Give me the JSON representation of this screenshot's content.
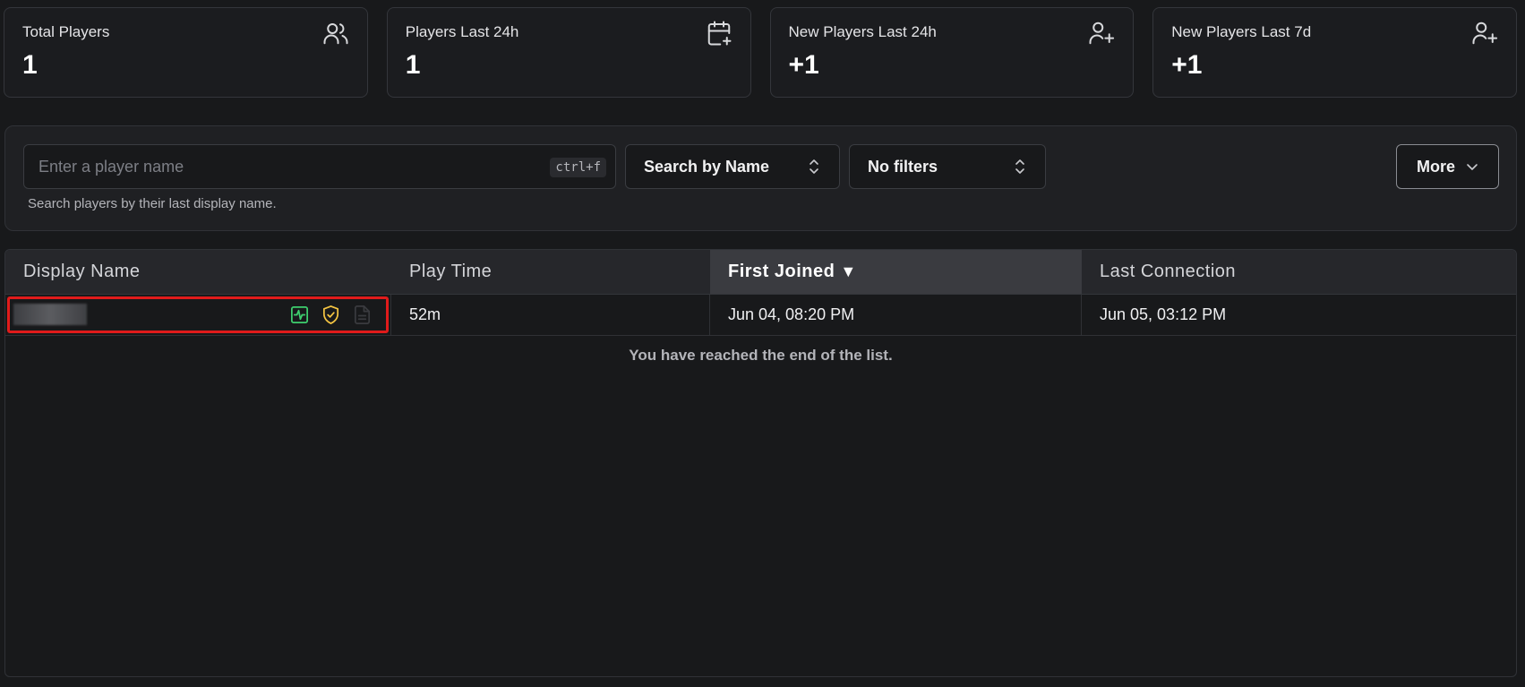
{
  "stats": [
    {
      "title": "Total Players",
      "value": "1",
      "icon": "users-icon"
    },
    {
      "title": "Players Last 24h",
      "value": "1",
      "icon": "calendar-plus-icon"
    },
    {
      "title": "New Players Last 24h",
      "value": "+1",
      "icon": "user-plus-icon"
    },
    {
      "title": "New Players Last 7d",
      "value": "+1",
      "icon": "user-plus-icon"
    }
  ],
  "search": {
    "placeholder": "Enter a player name",
    "value": "",
    "shortcut": "ctrl+f",
    "mode_label": "Search by Name",
    "filters_label": "No filters",
    "more_label": "More",
    "help_text": "Search players by their last display name."
  },
  "table": {
    "columns": [
      "Display Name",
      "Play Time",
      "First Joined",
      "Last Connection"
    ],
    "sorted_column": "First Joined",
    "sort_indicator": "▼",
    "rows": [
      {
        "display_name": "",
        "icons": [
          "activity-icon",
          "shield-check-icon",
          "document-icon"
        ],
        "play_time": "52m",
        "first_joined": "Jun 04, 08:20 PM",
        "last_connection": "Jun 05, 03:12 PM"
      }
    ],
    "end_message": "You have reached the end of the list."
  },
  "colors": {
    "background": "#18191b",
    "highlight_border": "#e01b1b",
    "activity_icon": "#3ecf6e",
    "shield_icon": "#f5c542"
  }
}
